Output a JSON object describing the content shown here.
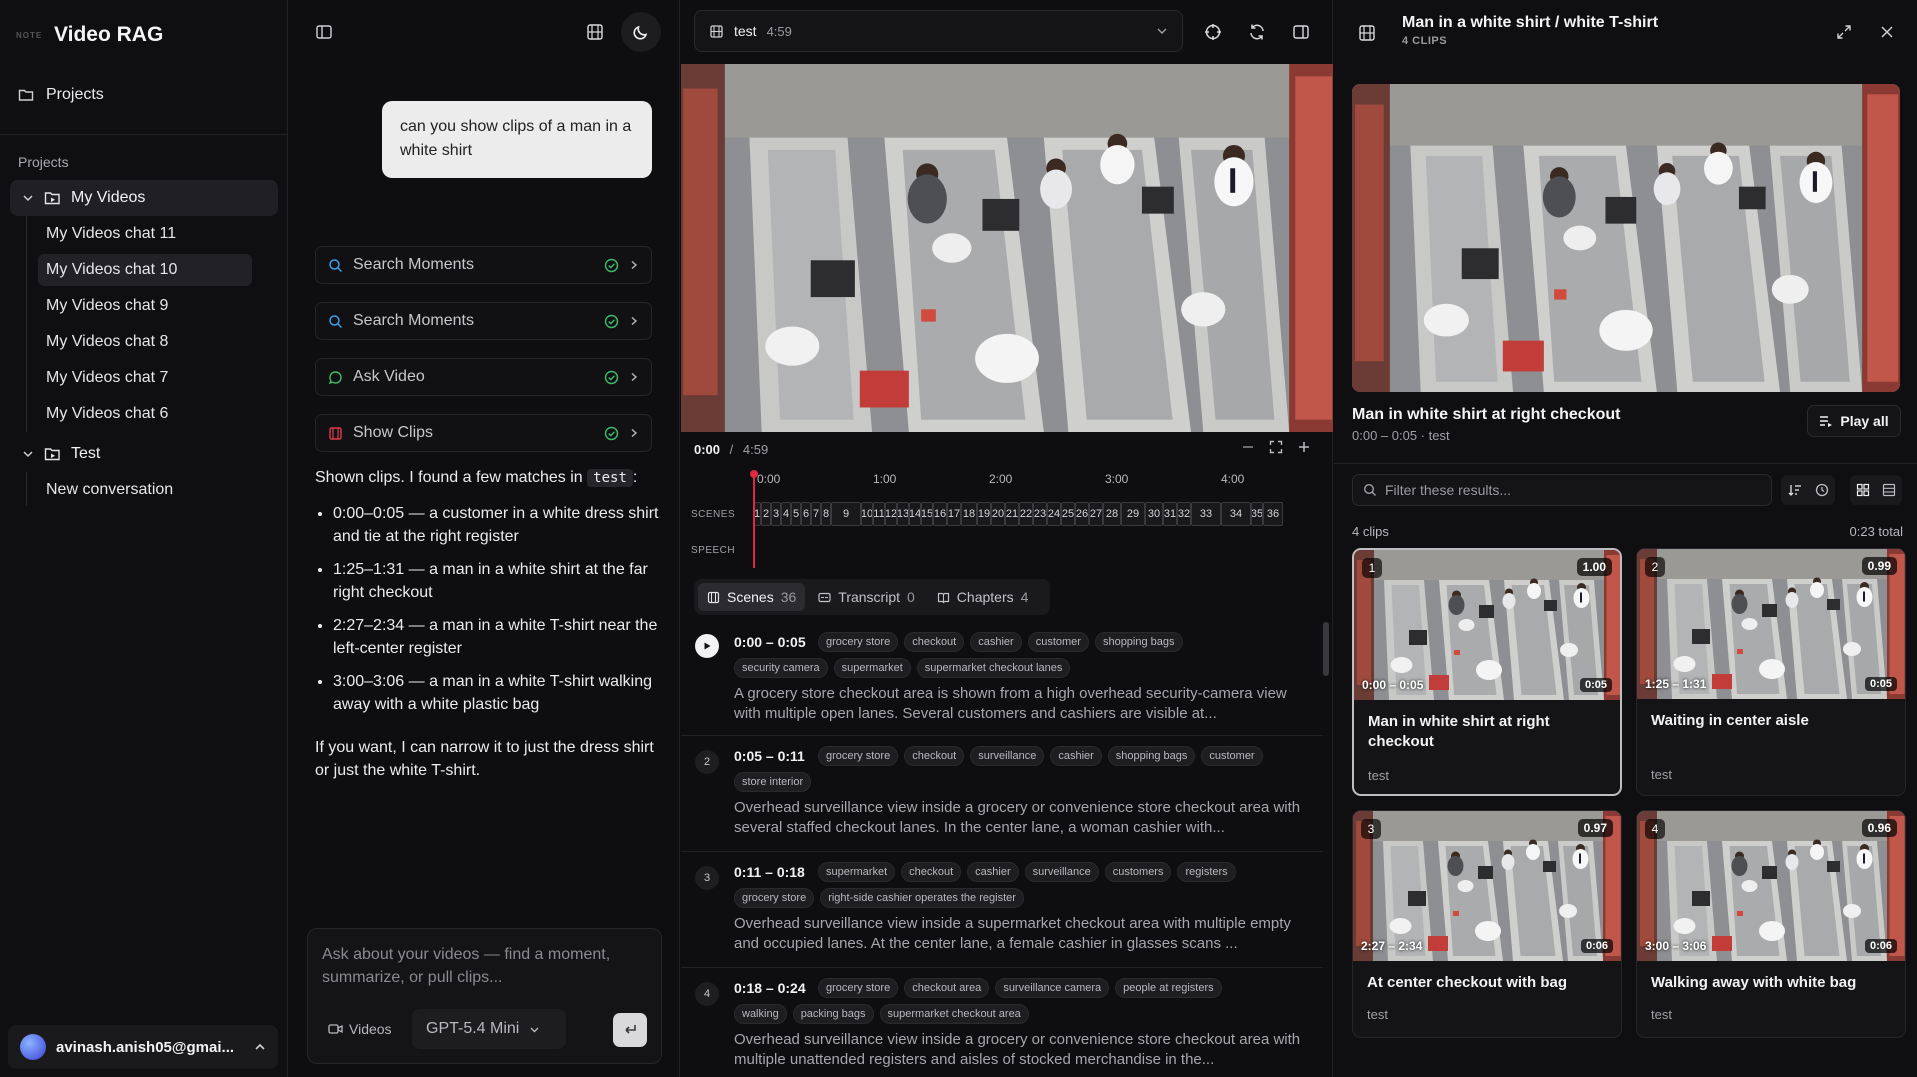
{
  "sidebar": {
    "logo_text": "NOTE",
    "app_title": "Video RAG",
    "projects_link": "Projects",
    "section_label": "Projects",
    "folders": [
      {
        "label": "My Videos",
        "items": [
          "My Videos chat 11",
          "My Videos chat 10",
          "My Videos chat 9",
          "My Videos chat 8",
          "My Videos chat 7",
          "My Videos chat 6"
        ],
        "active_item": 1
      },
      {
        "label": "Test",
        "items": [
          "New conversation"
        ]
      }
    ],
    "user_email": "avinash.anish05@gmai..."
  },
  "chat": {
    "user_message": "can you show clips of a man in a white shirt",
    "tool_calls": [
      {
        "label": "Search Moments",
        "icon": "search-icon"
      },
      {
        "label": "Search Moments",
        "icon": "search-icon"
      },
      {
        "label": "Ask Video",
        "icon": "chat-icon"
      },
      {
        "label": "Show Clips",
        "icon": "film-icon"
      }
    ],
    "reply_intro": "Shown clips. I found a few matches in",
    "reply_chip": "test",
    "reply_intro_end": ":",
    "reply_items": [
      "0:00–0:05 — a customer in a white dress shirt and tie at the right register",
      "1:25–1:31 — a man in a white shirt at the far right checkout",
      "2:27–2:34 — a man in a white T-shirt near the left-center register",
      "3:00–3:06 — a man in a white T-shirt walking away with a white plastic bag"
    ],
    "reply_footer": "If you want, I can narrow it to just the dress shirt or just the white T-shirt.",
    "composer_placeholder": "Ask about your videos — find a moment, summarize, or pull clips...",
    "videos_label": "Videos",
    "model_label": "GPT-5.4 Mini"
  },
  "video": {
    "name": "test",
    "duration": "4:59",
    "current_time": "0:00",
    "separator": "/",
    "total_time": "4:59",
    "ruler_ticks": [
      "0:00",
      "1:00",
      "2:00",
      "3:00",
      "4:00"
    ],
    "track_labels": {
      "scenes": "SCENES",
      "speech": "SPEECH"
    },
    "scene_markers": [
      "1",
      "2",
      "3",
      "4",
      "5",
      "6",
      "7",
      "8",
      "9",
      "10",
      "11",
      "12",
      "13",
      "14",
      "15",
      "16",
      "17",
      "18",
      "19",
      "20",
      "21",
      "22",
      "23",
      "24",
      "25",
      "26",
      "27",
      "28",
      "29",
      "30",
      "31",
      "32",
      "33",
      "34",
      "35",
      "36"
    ],
    "tabs": [
      {
        "label": "Scenes",
        "count": "36"
      },
      {
        "label": "Transcript",
        "count": "0"
      },
      {
        "label": "Chapters",
        "count": "4"
      }
    ],
    "scenes": [
      {
        "index": "1",
        "time": "0:00 – 0:05",
        "tags": [
          "grocery store",
          "checkout",
          "cashier",
          "customer",
          "shopping bags",
          "security camera",
          "supermarket",
          "supermarket checkout lanes"
        ],
        "desc": "A grocery store checkout area is shown from a high overhead security-camera view with multiple open lanes. Several customers and cashiers are visible at..."
      },
      {
        "index": "2",
        "time": "0:05 – 0:11",
        "tags": [
          "grocery store",
          "checkout",
          "surveillance",
          "cashier",
          "shopping bags",
          "customer",
          "store interior"
        ],
        "desc": "Overhead surveillance view inside a grocery or convenience store checkout area with several staffed checkout lanes. In the center lane, a woman cashier with..."
      },
      {
        "index": "3",
        "time": "0:11 – 0:18",
        "tags": [
          "supermarket",
          "checkout",
          "cashier",
          "surveillance",
          "customers",
          "registers",
          "grocery store",
          "right-side cashier operates the register"
        ],
        "desc": "Overhead surveillance view inside a supermarket checkout area with multiple empty and occupied lanes. At the center lane, a female cashier in glasses scans ..."
      },
      {
        "index": "4",
        "time": "0:18 – 0:24",
        "tags": [
          "grocery store",
          "checkout area",
          "surveillance camera",
          "people at registers",
          "walking",
          "packing bags",
          "supermarket checkout area"
        ],
        "desc": "Overhead surveillance view inside a grocery or convenience store checkout area with multiple unattended registers and aisles of stocked merchandise in the..."
      }
    ]
  },
  "panel": {
    "title": "Man in a white shirt / white T-shirt",
    "subtitle": "4 CLIPS",
    "current_clip_title": "Man in white shirt at right checkout",
    "current_clip_meta": "0:00 – 0:05 · test",
    "play_all": "Play all",
    "filter_placeholder": "Filter these results...",
    "clips_count": "4 clips",
    "clips_total": "0:23 total",
    "clips": [
      {
        "num": "1",
        "score": "1.00",
        "range": "0:00 – 0:05",
        "dur": "0:05",
        "title": "Man in white shirt at right checkout",
        "source": "test"
      },
      {
        "num": "2",
        "score": "0.99",
        "range": "1:25 – 1:31",
        "dur": "0:05",
        "title": "Waiting in center aisle",
        "source": "test"
      },
      {
        "num": "3",
        "score": "0.97",
        "range": "2:27 – 2:34",
        "dur": "0:06",
        "title": "At center checkout with bag",
        "source": "test"
      },
      {
        "num": "4",
        "score": "0.96",
        "range": "3:00 – 3:06",
        "dur": "0:06",
        "title": "Walking away with white bag",
        "source": "test"
      }
    ]
  },
  "colors": {
    "accent_green": "#3fbf6a",
    "playhead": "#e0283e",
    "background": "#0e0e10"
  }
}
